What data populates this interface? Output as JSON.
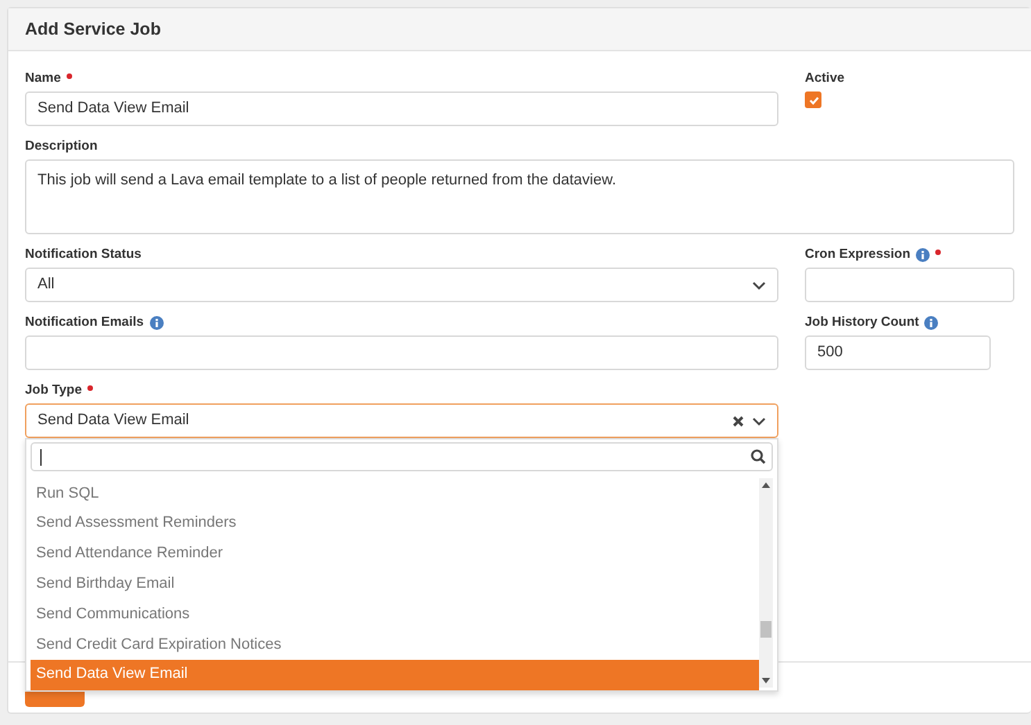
{
  "card": {
    "title": "Add Service Job"
  },
  "name": {
    "label": "Name",
    "required": true,
    "value": "Send Data View Email"
  },
  "active": {
    "label": "Active",
    "checked": true
  },
  "description": {
    "label": "Description",
    "value": "This job will send a Lava email template to a list of people returned from the dataview."
  },
  "notification_status": {
    "label": "Notification Status",
    "value": "All"
  },
  "cron_expression": {
    "label": "Cron Expression",
    "info": true,
    "required": true
  },
  "notification_emails": {
    "label": "Notification Emails",
    "info": true
  },
  "job_history_count": {
    "label": "Job History Count",
    "info": true,
    "value": "500"
  },
  "job_type": {
    "label": "Job Type",
    "required": true,
    "value": "Send Data View Email",
    "open": true,
    "options": [
      {
        "label": "Run SQL",
        "selected": false
      },
      {
        "label": "Send Assessment Reminders",
        "selected": false
      },
      {
        "label": "Send Attendance Reminder",
        "selected": false
      },
      {
        "label": "Send Birthday Email",
        "selected": false
      },
      {
        "label": "Send Communications",
        "selected": false
      },
      {
        "label": "Send Credit Card Expiration Notices",
        "selected": false
      },
      {
        "label": "Send Data View Email",
        "selected": true
      }
    ]
  },
  "buttons": [
    {
      "kind": "primary"
    }
  ]
}
